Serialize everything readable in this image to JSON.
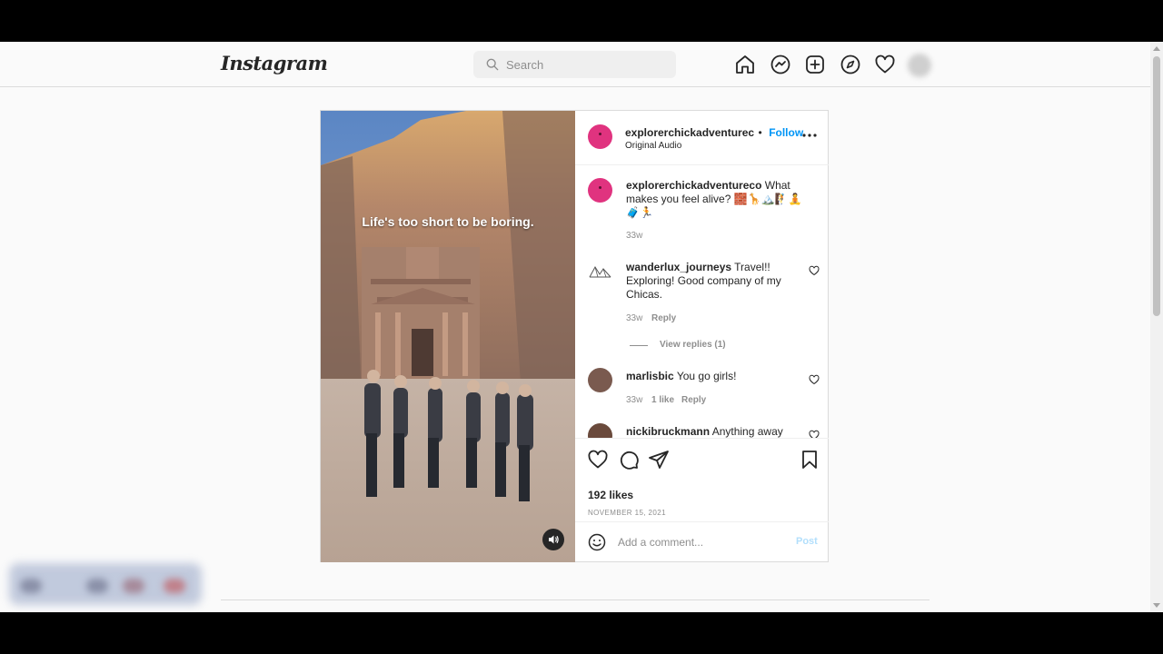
{
  "nav": {
    "logo": "Instagram",
    "search_placeholder": "Search"
  },
  "post": {
    "author": "explorerchickadventurec",
    "separator": "•",
    "follow_label": "Follow",
    "audio": "Original Audio",
    "video_caption": "Life's too short to be boring.",
    "caption": {
      "username": "explorerchickadventureco",
      "text": "What makes you feel alive? 🧱🦒🏔️🧗🧘",
      "text_line2": "🧳🏃",
      "time": "33w"
    },
    "comments": [
      {
        "username": "wanderlux_journeys",
        "text_line1": "Travel!!",
        "text_line2": "Exploring! Good company of my",
        "text_line3": "Chicas.",
        "time": "33w",
        "reply": "Reply",
        "view_replies": "View replies (1)"
      },
      {
        "username": "marlisbic",
        "text": "You go girls!",
        "time": "33w",
        "likes": "1 like",
        "reply": "Reply"
      },
      {
        "username": "nickibruckmann",
        "text": "Anything away"
      }
    ],
    "likes": "192 likes",
    "date": "NOVEMBER 15, 2021",
    "comment_placeholder": "Add a comment...",
    "post_label": "Post"
  }
}
